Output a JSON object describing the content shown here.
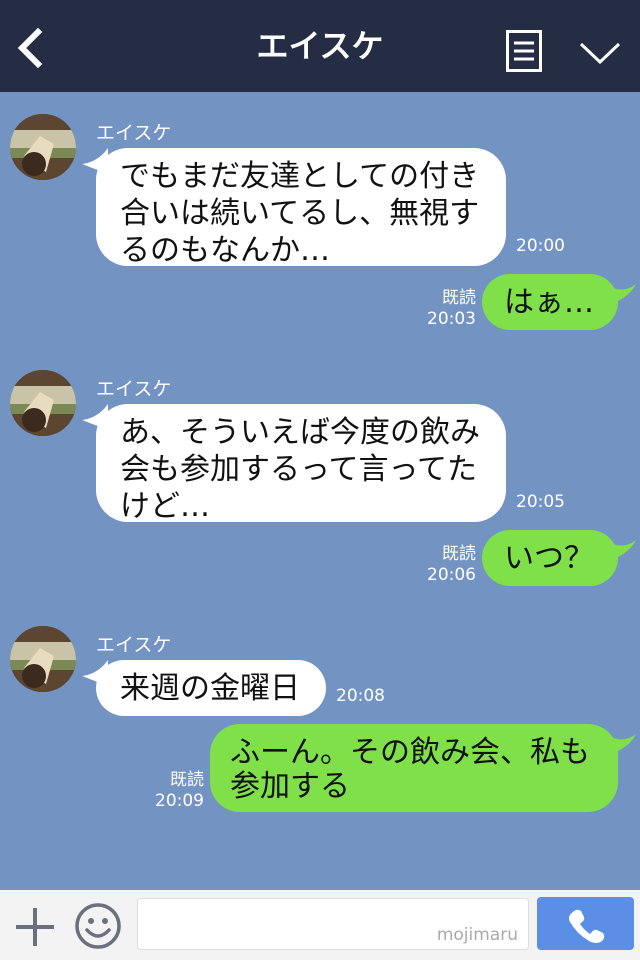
{
  "header": {
    "title": "エイスケ"
  },
  "messages": [
    {
      "sender": "エイスケ",
      "text": "でもまだ友達としての付き合いは続いてるし、無視するのもなんか…",
      "time": "20:00"
    },
    {
      "status": "既読",
      "time": "20:03",
      "text": "はぁ…"
    },
    {
      "sender": "エイスケ",
      "text": "あ、そういえば今度の飲み会も参加するって言ってたけど…",
      "time": "20:05"
    },
    {
      "status": "既読",
      "time": "20:06",
      "text": "いつ？"
    },
    {
      "sender": "エイスケ",
      "text": "来週の金曜日",
      "time": "20:08"
    },
    {
      "status": "既読",
      "time": "20:09",
      "text": "ふーん。その飲み会、私も参加する"
    }
  ],
  "footer": {
    "watermark": "mojimaru"
  },
  "colors": {
    "header_bg": "#242d44",
    "chat_bg": "#7393c3",
    "incoming_bubble": "#ffffff",
    "outgoing_bubble": "#7fe04a",
    "call_button": "#5b8fe6"
  },
  "icons": [
    "back-arrow-icon",
    "menu-icon",
    "chevron-down-icon",
    "plus-icon",
    "smiley-icon",
    "phone-icon"
  ]
}
